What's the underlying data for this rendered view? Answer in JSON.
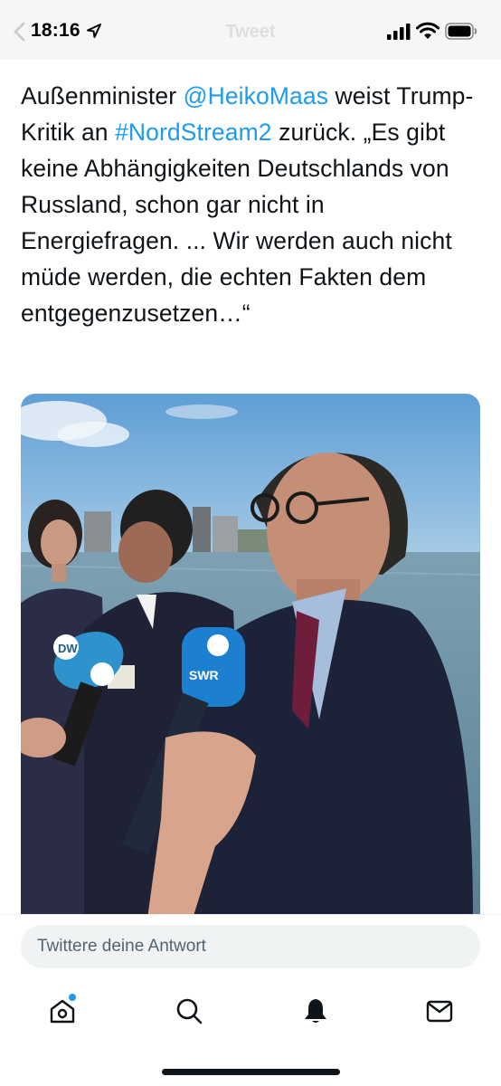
{
  "status_bar": {
    "time": "18:16",
    "title": "Tweet",
    "icons": [
      "location-arrow-icon",
      "cellular-signal-icon",
      "wifi-icon",
      "battery-icon"
    ]
  },
  "tweet": {
    "segments": [
      {
        "text": "Außenminister ",
        "type": "text"
      },
      {
        "text": "@HeikoMaas",
        "type": "mention"
      },
      {
        "text": " weist Trump-Kritik an ",
        "type": "text"
      },
      {
        "text": "#NordStream2",
        "type": "hashtag"
      },
      {
        "text": " zurück. „Es gibt keine Abhängigkeiten Deutschlands von Russland, schon gar nicht in Energiefragen. ... Wir werden auch nicht müde werden, die echten Fakten dem entgegenzusetzen…“",
        "type": "text"
      }
    ],
    "photo": {
      "mic_labels": [
        "SWR",
        "DW"
      ]
    }
  },
  "reply": {
    "placeholder": "Twittere deine Antwort"
  },
  "tab_bar": {
    "items": [
      "home-icon",
      "search-icon",
      "notifications-icon",
      "messages-icon"
    ]
  },
  "colors": {
    "link": "#1d9bf0",
    "text": "#0f1419",
    "input_bg": "#eff3f4",
    "placeholder": "#536471"
  }
}
